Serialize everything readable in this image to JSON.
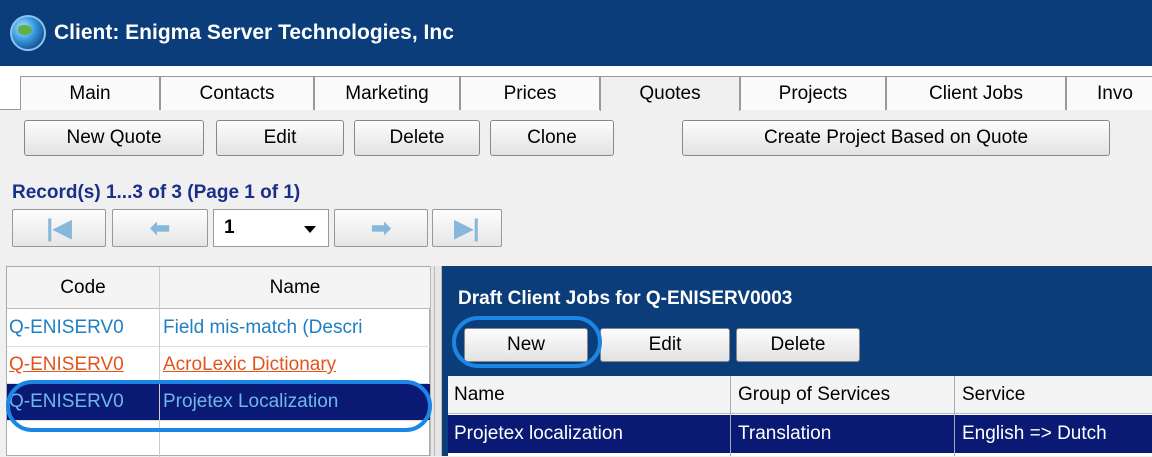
{
  "window": {
    "title": "Client: Enigma Server Technologies, Inc"
  },
  "tabs": [
    "Main",
    "Contacts",
    "Marketing",
    "Prices",
    "Quotes",
    "Projects",
    "Client Jobs",
    "Invo"
  ],
  "active_tab": "Quotes",
  "toolbar": {
    "new_quote": "New Quote",
    "edit": "Edit",
    "delete": "Delete",
    "clone": "Clone",
    "create_project": "Create Project Based on Quote"
  },
  "records": {
    "summary": "Record(s) 1...3 of 3 (Page 1 of 1)"
  },
  "pager": {
    "page": "1"
  },
  "quotes_table": {
    "columns": [
      "Code",
      "Name"
    ],
    "rows": [
      {
        "code": "Q-ENISERV0",
        "name": "Field mis-match (Descri",
        "style": "blue"
      },
      {
        "code": "Q-ENISERV0",
        "name": "AcroLexic Dictionary",
        "style": "red"
      },
      {
        "code": "Q-ENISERV0",
        "name": "Projetex Localization",
        "style": "selected"
      }
    ]
  },
  "draft_jobs": {
    "title": "Draft Client Jobs for  Q-ENISERV0003",
    "new": "New",
    "edit": "Edit",
    "delete": "Delete",
    "columns": [
      "Name",
      "Group of Services",
      "Service"
    ],
    "rows": [
      {
        "name": "Projetex localization",
        "group": "Translation",
        "service": "English => Dutch"
      }
    ]
  },
  "colors": {
    "title_bar": "#0a3d7a",
    "selected_row": "#0a1a74",
    "highlight_ring": "#1c86e6",
    "link_blue": "#1f7fc2",
    "link_red": "#e2541e"
  }
}
